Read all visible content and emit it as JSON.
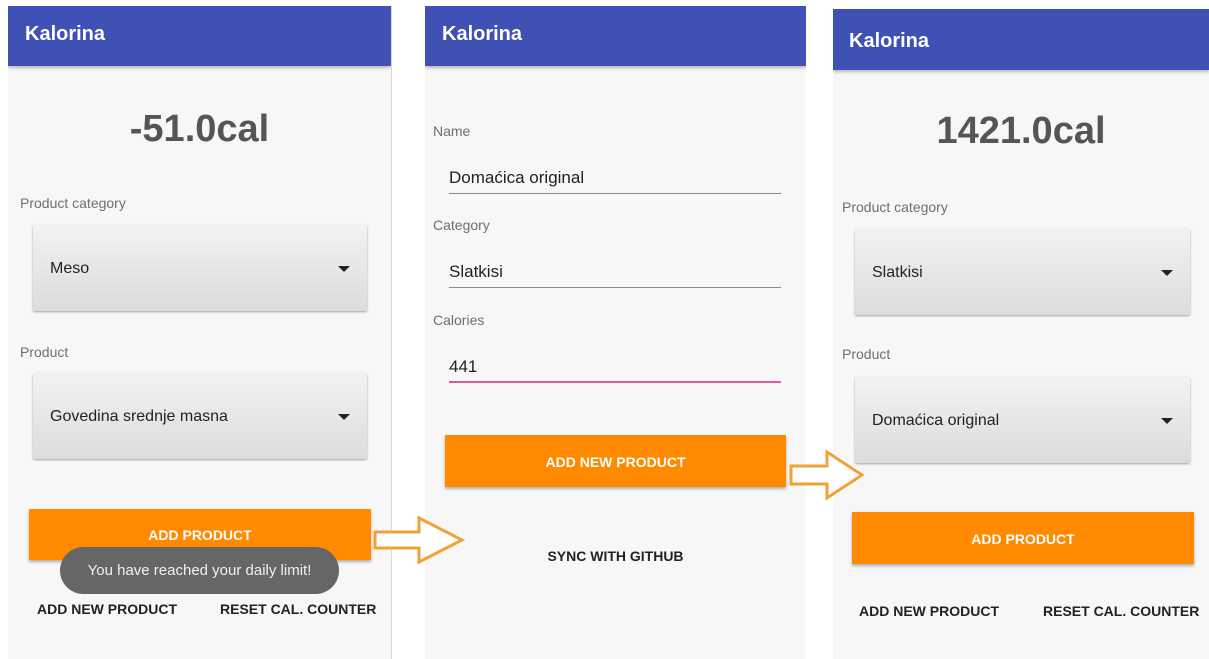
{
  "screens": [
    {
      "app_title": "Kalorina",
      "calorie_counter": "-51.0cal",
      "product_category_label": "Product category",
      "product_category_value": "Meso",
      "product_label": "Product",
      "product_value": "Govedina srednje masna",
      "add_product_button": "ADD PRODUCT",
      "toast": "You have reached your daily limit!",
      "add_new_product_button": "ADD NEW PRODUCT",
      "reset_button": "RESET CAL. COUNTER"
    },
    {
      "app_title": "Kalorina",
      "name_label": "Name",
      "name_value": "Domaćica original",
      "category_label": "Category",
      "category_value": "Slatkisi",
      "calories_label": "Calories",
      "calories_value": "441",
      "add_new_product_button": "ADD NEW PRODUCT",
      "sync_button": "SYNC WITH GITHUB"
    },
    {
      "app_title": "Kalorina",
      "calorie_counter": "1421.0cal",
      "product_category_label": "Product category",
      "product_category_value": "Slatkisi",
      "product_label": "Product",
      "product_value": "Domaćica original",
      "add_product_button": "ADD PRODUCT",
      "add_new_product_button": "ADD NEW PRODUCT",
      "reset_button": "RESET CAL. COUNTER"
    }
  ],
  "colors": {
    "appbar": "#3f51b5",
    "accent_button": "#ff8a00",
    "active_underline": "#e0569a",
    "arrow_stroke": "#f0a23a"
  },
  "icons": [
    "dropdown-caret-icon",
    "flow-arrow-icon"
  ]
}
